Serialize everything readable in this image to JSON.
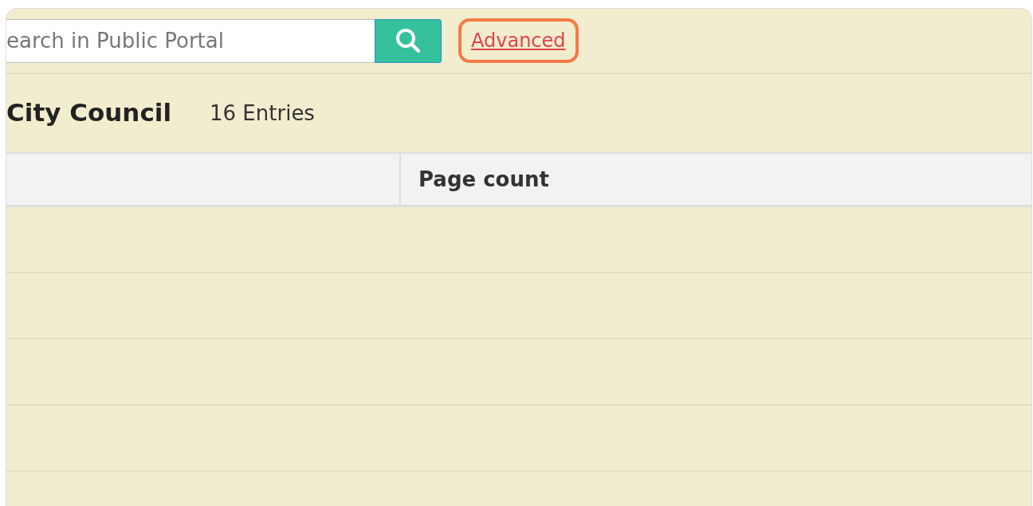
{
  "search": {
    "placeholder": "earch in Public Portal"
  },
  "advanced_link": {
    "label": "Advanced",
    "highlighted": true
  },
  "heading": {
    "title": "City Council",
    "count": "16 Entries"
  },
  "table": {
    "columns": [
      {
        "label": "Page count"
      }
    ]
  }
}
